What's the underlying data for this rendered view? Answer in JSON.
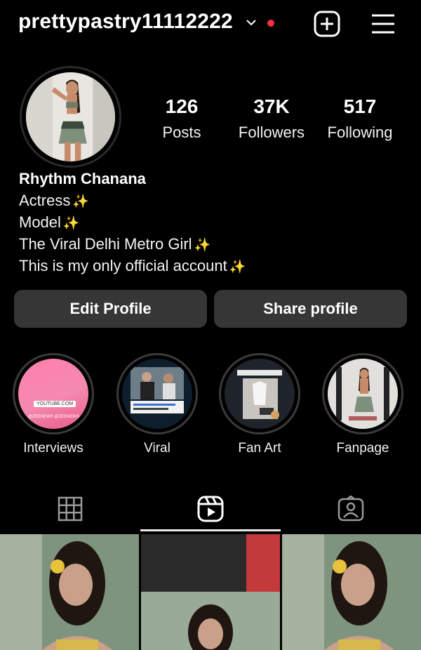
{
  "header": {
    "username": "prettypastry11112222",
    "icons": [
      "chevron-down-icon",
      "notification-dot",
      "plus-square-icon",
      "menu-icon"
    ]
  },
  "stats": [
    {
      "value": "126",
      "label": "Posts"
    },
    {
      "value": "37K",
      "label": "Followers"
    },
    {
      "value": "517",
      "label": "Following"
    }
  ],
  "bio": {
    "name": "Rhythm Chanana",
    "lines": [
      "Actress",
      "Model",
      "The Viral Delhi Metro Girl",
      "This is my only official account"
    ],
    "sparkle": "✨"
  },
  "buttons": {
    "edit": "Edit Profile",
    "share": "Share profile"
  },
  "highlights": [
    {
      "label": "Interviews",
      "badge": "YOUTUBE.COM",
      "credit": "@ZEENEWS @ZEENEWS"
    },
    {
      "label": "Viral"
    },
    {
      "label": "Fan Art"
    },
    {
      "label": "Fanpage"
    }
  ],
  "tabs": [
    {
      "name": "grid",
      "icon": "grid-icon",
      "active": false
    },
    {
      "name": "reels",
      "icon": "reels-icon",
      "active": true
    },
    {
      "name": "tagged",
      "icon": "tagged-icon",
      "active": false
    }
  ],
  "colors": {
    "background": "#000000",
    "button": "#363636",
    "notification": "#ff3040",
    "sparkle": "#ffd85a"
  }
}
